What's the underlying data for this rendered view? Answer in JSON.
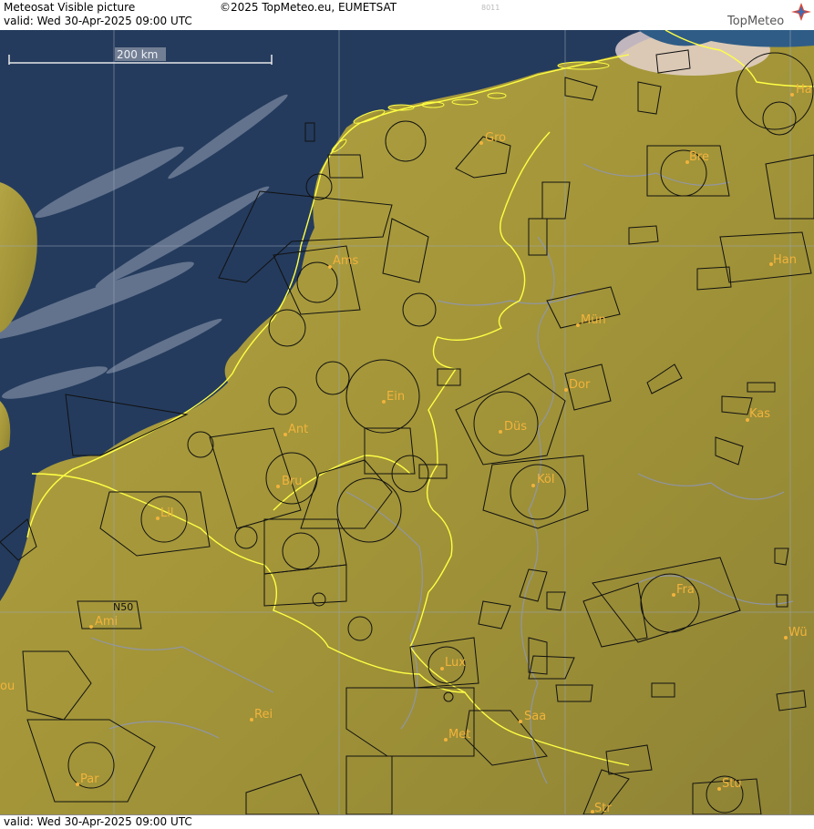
{
  "header": {
    "title": "Meteosat Visible picture",
    "copyright": "©2025 TopMeteo.eu, EUMETSAT",
    "code": "8011",
    "valid": "valid:  Wed   30-Apr-2025   09:00 UTC",
    "brand": "TopMeteo"
  },
  "footer": {
    "valid": "valid:  Wed   30-Apr-2025   09:00 UTC"
  },
  "map": {
    "scale_label": "200 km",
    "extra_label": "N50",
    "cities": [
      {
        "id": "gro",
        "label": "Gro"
      },
      {
        "id": "bre",
        "label": "Bre"
      },
      {
        "id": "ha",
        "label": "Ha"
      },
      {
        "id": "ams",
        "label": "Ams"
      },
      {
        "id": "han",
        "label": "Han"
      },
      {
        "id": "mun",
        "label": "Mün"
      },
      {
        "id": "ein",
        "label": "Ein"
      },
      {
        "id": "dor",
        "label": "Dor"
      },
      {
        "id": "kas",
        "label": "Kas"
      },
      {
        "id": "ant",
        "label": "Ant"
      },
      {
        "id": "dus",
        "label": "Düs"
      },
      {
        "id": "bru",
        "label": "Bru"
      },
      {
        "id": "kol",
        "label": "Köl"
      },
      {
        "id": "lil",
        "label": "Lil"
      },
      {
        "id": "fra",
        "label": "Fra"
      },
      {
        "id": "ami",
        "label": "Ami"
      },
      {
        "id": "wu",
        "label": "Wü"
      },
      {
        "id": "lux",
        "label": "Lux"
      },
      {
        "id": "saa",
        "label": "Saa"
      },
      {
        "id": "rei",
        "label": "Rei"
      },
      {
        "id": "met",
        "label": "Met"
      },
      {
        "id": "par",
        "label": "Par"
      },
      {
        "id": "stu",
        "label": "Stu"
      },
      {
        "id": "str",
        "label": "Str"
      },
      {
        "id": "rou",
        "label": "ou"
      }
    ]
  },
  "colors": {
    "sea": "#233a5c",
    "land": "#a99a3e",
    "border": "#ffff44",
    "city": "#f2b33c",
    "airspace": "#111111"
  }
}
